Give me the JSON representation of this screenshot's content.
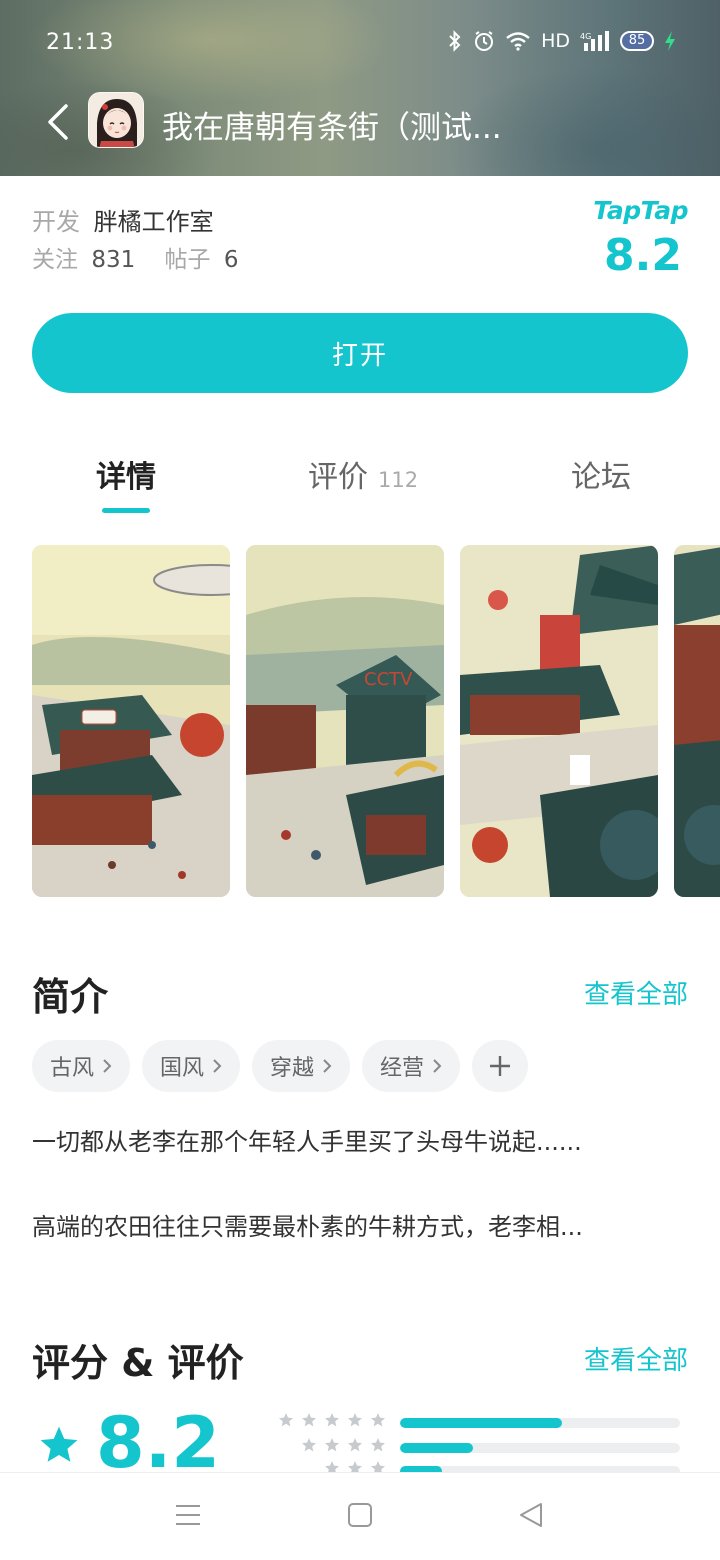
{
  "status_bar": {
    "time": "21:13",
    "network": "HD",
    "battery": "85"
  },
  "header": {
    "title": "我在唐朝有条街（测试...",
    "icons": [
      "back-arrow-icon",
      "app-icon"
    ]
  },
  "info": {
    "dev_label": "开发",
    "dev_name": "胖橘工作室",
    "follow_label": "关注",
    "follow_count": "831",
    "post_label": "帖子",
    "post_count": "6",
    "brand": "TapTap",
    "score": "8.2"
  },
  "open_button": "打开",
  "tabs": [
    {
      "label": "详情",
      "active": true
    },
    {
      "label": "评价",
      "count": "112"
    },
    {
      "label": "论坛"
    }
  ],
  "intro": {
    "title": "简介",
    "see_all": "查看全部",
    "tags": [
      "古风",
      "国风",
      "穿越",
      "经营"
    ],
    "paragraph1": "一切都从老李在那个年轻人手里买了头母牛说起......",
    "paragraph2": "高端的农田往往只需要最朴素的牛耕方式，老李相..."
  },
  "rating": {
    "title": "评分 & 评价",
    "see_all": "查看全部",
    "score": "8.2",
    "distribution": [
      0.58,
      0.26,
      0.15
    ]
  },
  "colors": {
    "accent": "#15c5ce"
  }
}
